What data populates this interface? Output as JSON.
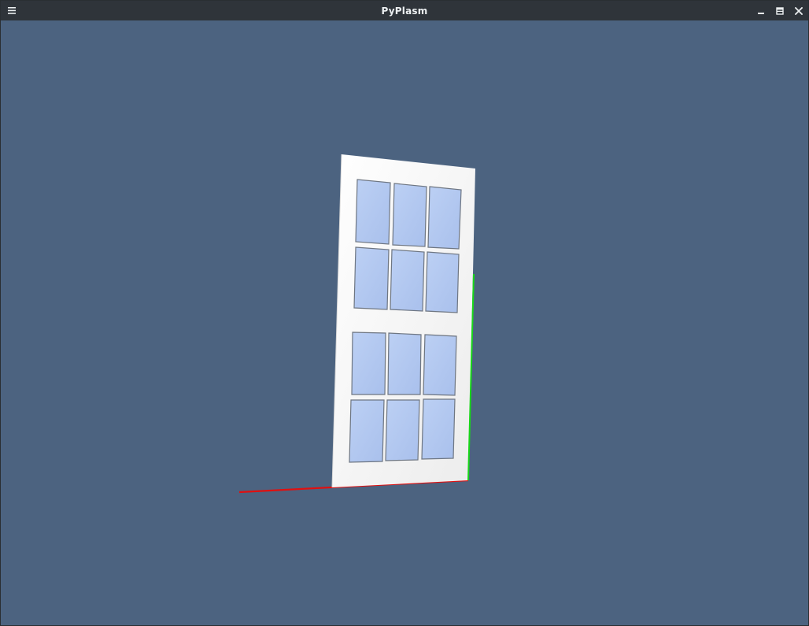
{
  "window": {
    "title": "PyPlasm",
    "menu_icon": "hamburger-menu-icon",
    "minimize_icon": "minimize-icon",
    "maximize_icon": "maximize-icon",
    "close_icon": "close-icon"
  },
  "scene": {
    "object": "window-frame-model",
    "background_color": "#4c6380",
    "frame_color": "#f7f7f7",
    "glass_color": "#b5caf1",
    "pane_rows": 4,
    "pane_cols": 3,
    "axes": {
      "x_axis_color": "#e01010",
      "y_axis_color": "#18d818"
    }
  }
}
